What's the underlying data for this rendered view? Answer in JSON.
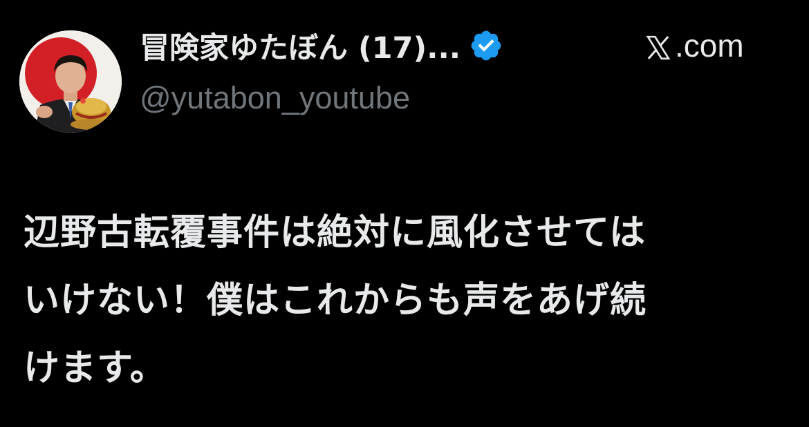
{
  "tweet": {
    "display_name": "冒険家ゆたぼん (17)...",
    "verified_icon": "verified-badge-icon",
    "handle": "@yutabon_youtube",
    "site_label": ".com",
    "site_logo": "x-logo-icon",
    "text": "辺野古転覆事件は絶対に風化させては\nいけない！僕はこれからも声をあげ続\nけます。"
  },
  "colors": {
    "background": "#000000",
    "text_primary": "#e7e9ea",
    "text_secondary": "#71767b",
    "verified_blue": "#1d9bf0"
  }
}
